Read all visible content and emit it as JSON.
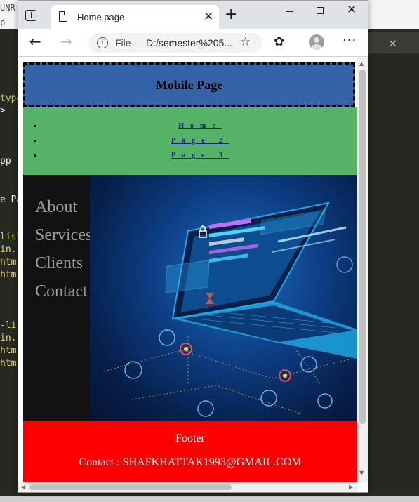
{
  "background_editor": {
    "top_fragments": [
      "UNR",
      "p"
    ],
    "code_lines": [
      "type",
      ">",
      "pp",
      "e Pa",
      "list",
      "in.",
      "htm.",
      "htm.",
      "-li",
      "in.",
      "htm.",
      "htm."
    ],
    "tab_close": "×"
  },
  "browser": {
    "tab_title": "Home page",
    "tab_close": "✕",
    "new_tab": "+",
    "window_close": "✕",
    "address": {
      "scheme_label": "File",
      "url": "D:/semester%205..."
    },
    "icons": {
      "back": "←",
      "forward": "→",
      "info": "i",
      "favorite": "☆",
      "extensions": "✿",
      "menu": "···"
    }
  },
  "page": {
    "header_title": "Mobile Page",
    "nav_items": [
      "Home",
      "Page 2",
      "Page 3"
    ],
    "sidebar_items": [
      "About",
      "Services",
      "Clients",
      "Contact"
    ],
    "footer_title": "Footer",
    "footer_contact": "Contact : SHAFKHATTAK1993@GMAIL.COM"
  },
  "scrollbars": {
    "up": "▲",
    "down": "▼",
    "left": "◀",
    "right": "▶"
  }
}
